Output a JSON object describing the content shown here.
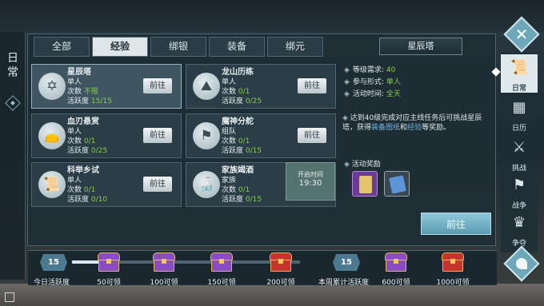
{
  "sidebar_title": "日常",
  "tabs": [
    {
      "label": "全部",
      "active": false
    },
    {
      "label": "经验",
      "active": true
    },
    {
      "label": "绑银",
      "active": false
    },
    {
      "label": "装备",
      "active": false
    },
    {
      "label": "绑元",
      "active": false
    }
  ],
  "activities": [
    {
      "name": "星辰塔",
      "type": "单人",
      "count_label": "次数",
      "count": "不限",
      "activity_label": "活跃度",
      "activity": "15/15",
      "button": "前往",
      "icon": "hexagram-icon"
    },
    {
      "name": "龙山历练",
      "type": "单人",
      "count_label": "次数",
      "count": "0/1",
      "activity_label": "活跃度",
      "activity": "0/25",
      "button": "前往",
      "icon": "mountain-badge-icon"
    },
    {
      "name": "血刃悬赏",
      "type": "单人",
      "count_label": "次数",
      "count": "0/1",
      "activity_label": "活跃度",
      "activity": "0/25",
      "button": "前往",
      "icon": "money-bag-icon"
    },
    {
      "name": "魔神分舵",
      "type": "组队",
      "count_label": "次数",
      "count": "0/1",
      "activity_label": "活跃度",
      "activity": "0/15",
      "button": "前往",
      "icon": "banner-icon"
    },
    {
      "name": "科举乡试",
      "type": "单人",
      "count_label": "次数",
      "count": "0/1",
      "activity_label": "活跃度",
      "activity": "0/10",
      "button": "前往",
      "icon": "scroll-icon"
    },
    {
      "name": "家族竭酒",
      "type": "家族",
      "count_label": "次数",
      "count": "0/1",
      "activity_label": "活跃度",
      "activity": "0/15",
      "button_time_label": "开启时间",
      "button_time": "19:30",
      "icon": "wine-jar-icon"
    }
  ],
  "detail": {
    "title": "星辰塔",
    "level_label": "等级需求:",
    "level": "40",
    "mode_label": "参与形式:",
    "mode": "单人",
    "time_label": "活动时间:",
    "time": "全天",
    "desc_prefix": "达到40级完成对应主线任务后可挑战星辰塔，获得",
    "desc_hl1": "装备图纸",
    "desc_mid": "和",
    "desc_hl2": "经验",
    "desc_suffix": "等奖励。",
    "reward_label": "活动奖励",
    "go_button": "前往"
  },
  "nav": [
    {
      "label": "日常",
      "icon": "daily-scroll-icon",
      "active": true
    },
    {
      "label": "日历",
      "icon": "calendar-icon",
      "active": false
    },
    {
      "label": "挑战",
      "icon": "crossed-swords-icon",
      "active": false
    },
    {
      "label": "战争",
      "icon": "war-banner-icon",
      "active": false
    },
    {
      "label": "争夺",
      "icon": "contest-icon",
      "active": false
    }
  ],
  "progress": {
    "today_value": "15",
    "today_label": "今日活跃度",
    "today_fill_fraction": 0.12,
    "today_chests": [
      {
        "label": "50可领",
        "color": "purple"
      },
      {
        "label": "100可领",
        "color": "purple"
      },
      {
        "label": "150可领",
        "color": "purple"
      },
      {
        "label": "200可领",
        "color": "red"
      }
    ],
    "week_value": "15",
    "week_label": "本周累计活跃度",
    "week_chests": [
      {
        "label": "600可领",
        "color": "purple"
      },
      {
        "label": "1000可领",
        "color": "red"
      }
    ]
  }
}
